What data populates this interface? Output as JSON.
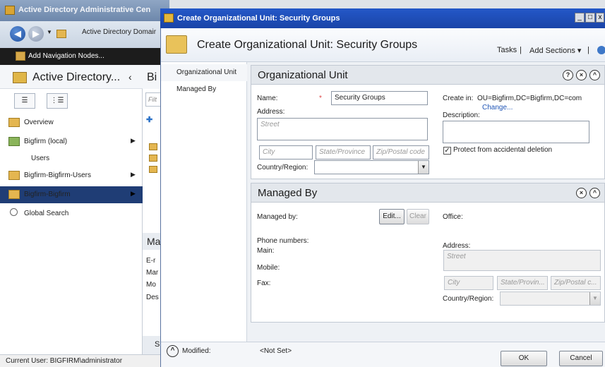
{
  "background_window": {
    "title": "Active Directory Administrative Cen",
    "breadcrumb": "Active Directory Domair",
    "toolbar_label": "Add Navigation Nodes...",
    "nav_title": "Active Directory...",
    "nav_items": [
      {
        "label": "Overview"
      },
      {
        "label": "Bigfirm (local)"
      },
      {
        "label": "Users"
      },
      {
        "label": "Bigfirm-Bigfirm-Users"
      },
      {
        "label": "Bigfirm-Bigfirm"
      },
      {
        "label": "Global Search"
      }
    ],
    "middle_header": "Bi",
    "filter_placeholder": "Filt",
    "middle_section": "Ma",
    "middle_rows": [
      "E-r",
      "Mar",
      "Mo",
      "Des"
    ],
    "middle_bottom": "S",
    "status_bar": "Current User: BIGFIRM\\administrator"
  },
  "dialog": {
    "title": "Create Organizational Unit: Security Groups",
    "header_title": "Create Organizational Unit: Security Groups",
    "tasks_label": "Tasks",
    "add_sections_label": "Add Sections",
    "nav": [
      {
        "label": "Organizational Unit"
      },
      {
        "label": "Managed By"
      }
    ],
    "org_unit": {
      "heading": "Organizational Unit",
      "name_label": "Name:",
      "name_value": "Security Groups",
      "address_label": "Address:",
      "street_placeholder": "Street",
      "city_placeholder": "City",
      "state_placeholder": "State/Province",
      "zip_placeholder": "Zip/Postal code",
      "country_label": "Country/Region:",
      "create_in_label": "Create in:",
      "create_in_value": "OU=Bigfirm,DC=Bigfirm,DC=com",
      "change_link": "Change...",
      "description_label": "Description:",
      "protect_label": "Protect from accidental deletion",
      "protect_checked": true
    },
    "managed_by": {
      "heading": "Managed By",
      "managed_by_label": "Managed by:",
      "edit_button": "Edit...",
      "clear_button": "Clear",
      "office_label": "Office:",
      "phone_label": "Phone numbers:",
      "main_label": "Main:",
      "mobile_label": "Mobile:",
      "fax_label": "Fax:",
      "address_label": "Address:",
      "street_placeholder": "Street",
      "city_placeholder": "City",
      "state_placeholder": "State/Provin...",
      "zip_placeholder": "Zip/Postal c...",
      "country_label": "Country/Region:"
    },
    "bottom": {
      "modified_label": "Modified:",
      "modified_value": "<Not Set>",
      "ok_button": "OK",
      "cancel_button": "Cancel"
    }
  },
  "colors": {
    "title_bar": "#1f4eb8",
    "selected_nav": "#1f3d75",
    "link": "#1f55b6"
  }
}
